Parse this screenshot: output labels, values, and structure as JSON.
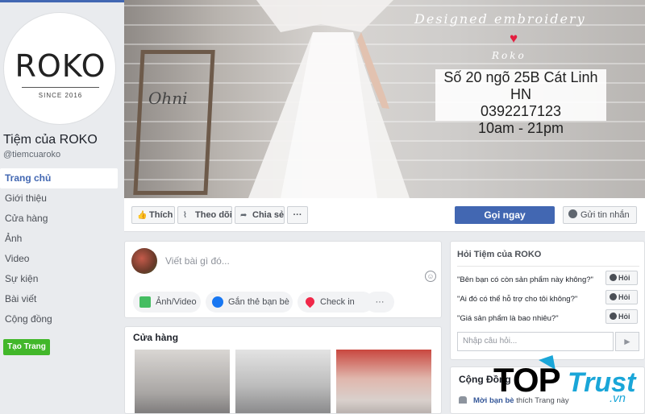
{
  "page": {
    "logo": "ROKO",
    "logo_since": "SINCE 2016",
    "name": "Tiệm của ROKO",
    "handle": "@tiemcuaroko"
  },
  "nav": {
    "items": [
      {
        "label": "Trang chủ"
      },
      {
        "label": "Giới thiệu"
      },
      {
        "label": "Cửa hàng"
      },
      {
        "label": "Ảnh"
      },
      {
        "label": "Video"
      },
      {
        "label": "Sự kiện"
      },
      {
        "label": "Bài viết"
      },
      {
        "label": "Cộng đồng"
      }
    ],
    "create_page": "Tạo Trang"
  },
  "cover": {
    "slogan": "Designed embroidery",
    "brand": "Roko",
    "sign_text": "Ohni",
    "address": "Số 20 ngõ 25B Cát Linh HN",
    "phone": "0392217123",
    "hours": "10am - 21pm"
  },
  "actions": {
    "like": "Thích",
    "follow": "Theo dõi",
    "share": "Chia sẻ",
    "more": "···",
    "call": "Gọi ngay",
    "message": "Gửi tin nhắn"
  },
  "composer": {
    "placeholder": "Viết bài gì đó...",
    "photo_video": "Ảnh/Video",
    "tag_friends": "Gắn thẻ bạn bè",
    "check_in": "Check in",
    "more": "···"
  },
  "shop": {
    "title": "Cửa hàng"
  },
  "ask": {
    "title": "Hỏi Tiệm của ROKO",
    "questions": [
      {
        "text": "\"Bên bạn có còn sản phẩm này không?\"",
        "button": "Hỏi"
      },
      {
        "text": "\"Ai đó có thể hỗ trợ cho tôi không?\"",
        "button": "Hỏi"
      },
      {
        "text": "\"Giá sản phẩm là bao nhiêu?\"",
        "button": "Hỏi"
      }
    ],
    "input_placeholder": "Nhập câu hỏi...",
    "send_icon": "►"
  },
  "community": {
    "title": "Cộng Đồng",
    "line_link": "Mời bạn bè",
    "line_rest": " thích Trang này"
  },
  "watermark": {
    "top": "TOP",
    "trust": "Trust",
    "vn": ".vn"
  },
  "colors": {
    "brand_blue": "#4267b2",
    "create_green": "#42b72a",
    "heart_red": "#e41e3f",
    "watermark_blue": "#1aa6d8"
  }
}
